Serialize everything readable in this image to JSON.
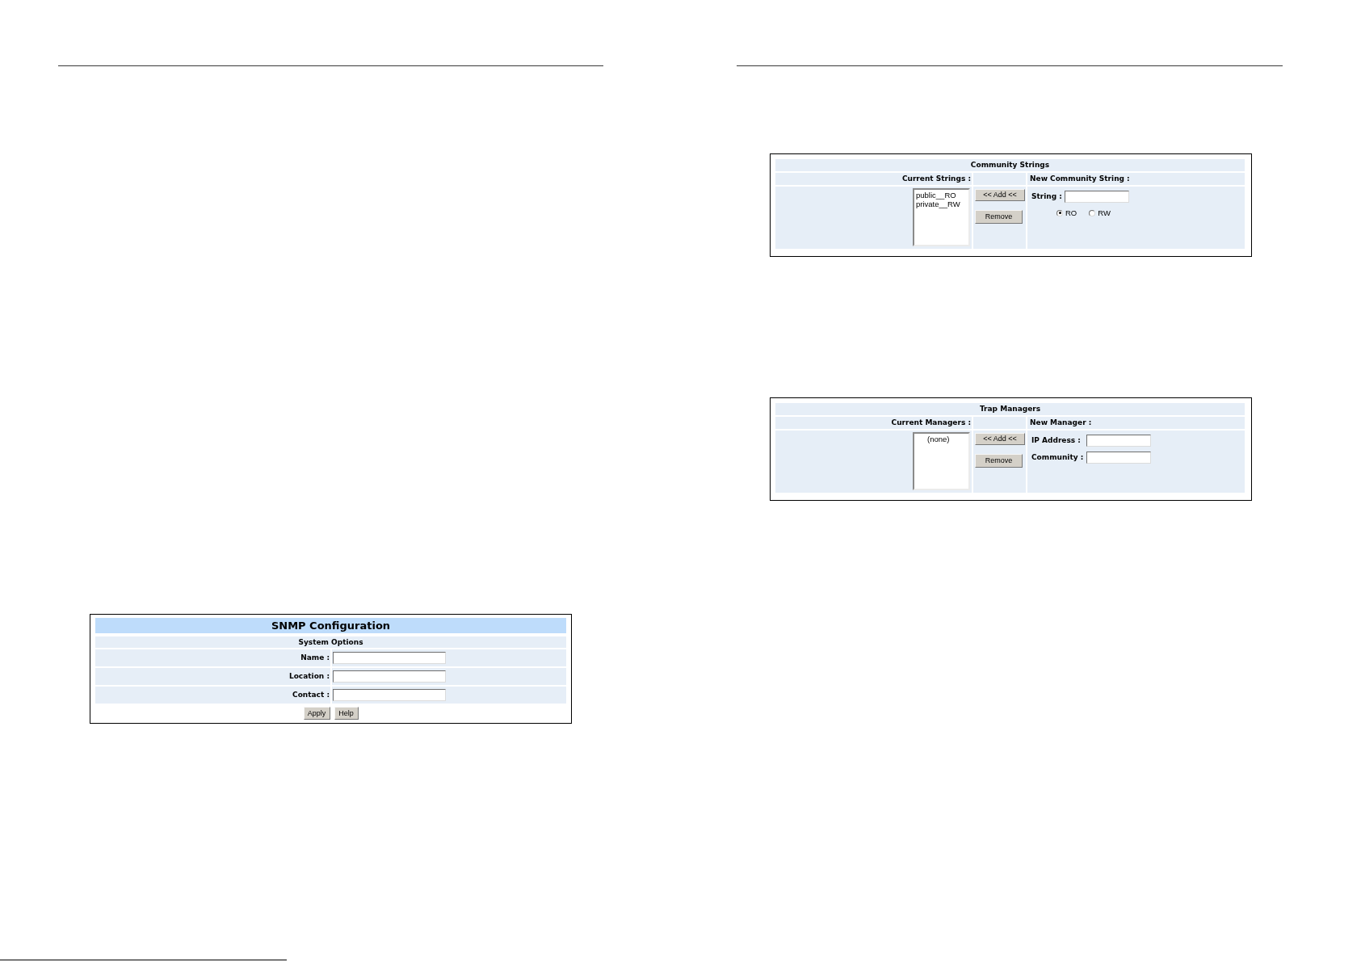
{
  "left_page": {
    "snmp_configuration": {
      "title": "SNMP Configuration",
      "section": "System Options",
      "fields": [
        {
          "label": "Name :"
        },
        {
          "label": "Location :"
        },
        {
          "label": "Contact :"
        }
      ],
      "buttons": [
        "Apply",
        "Help"
      ]
    }
  },
  "right_page": {
    "community_strings": {
      "title": "Community Strings",
      "current_header": "Current Strings :",
      "current_list": [
        {
          "text": "public__RO",
          "kind": "entry",
          "selected": false
        },
        {
          "text": "private__RW",
          "kind": "entry",
          "selected": false
        }
      ],
      "buttons": [
        "<< Add <<",
        "Remove"
      ],
      "new_header": "New Community String :",
      "fields": [
        {
          "label": "String :"
        }
      ],
      "access_options": [
        {
          "label": "RO",
          "selected": true
        },
        {
          "label": "RW",
          "selected": false
        }
      ]
    },
    "trap_managers": {
      "title": "Trap Managers",
      "current_header": "Current Managers :",
      "current_list": [
        {
          "text": "(none)",
          "kind": "placeholder",
          "selected": false
        }
      ],
      "buttons": [
        "<< Add <<",
        "Remove"
      ],
      "new_header": "New Manager :",
      "fields": [
        {
          "label": "IP Address :"
        },
        {
          "label": "Community :"
        }
      ]
    }
  }
}
